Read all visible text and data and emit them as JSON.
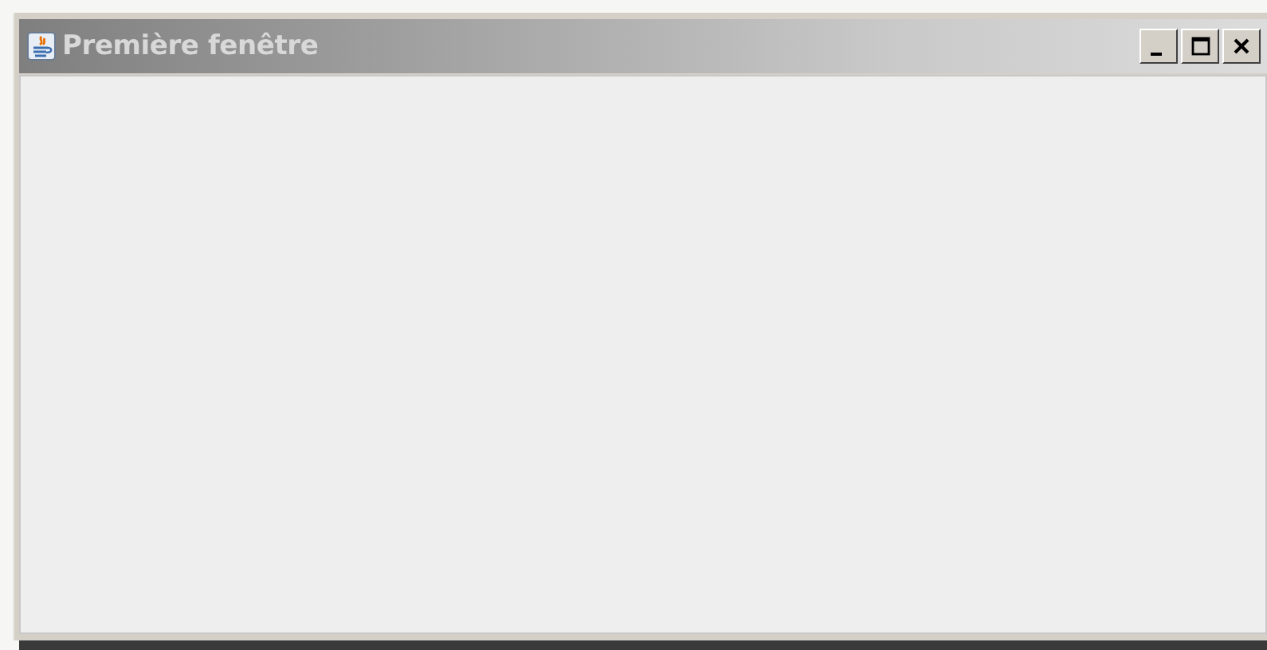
{
  "window": {
    "title": "Première fenêtre"
  }
}
